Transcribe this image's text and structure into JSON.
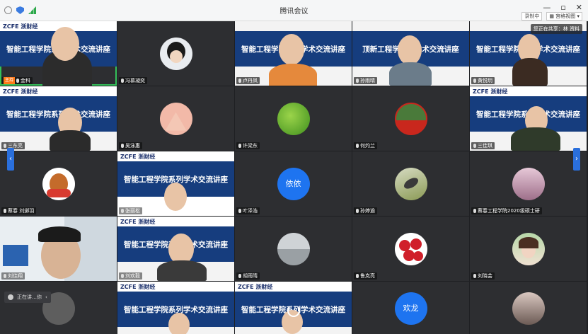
{
  "window": {
    "title": "腾讯会议"
  },
  "titlebar": {
    "minimize": "—",
    "restore": "▫",
    "close": "✕"
  },
  "toolbar": {
    "rec_badge": "录制中",
    "layout_label": "宫格视图"
  },
  "net_status": "您正在共享：林 资料",
  "slide": {
    "logo": "ZCFE 浙财经",
    "banner": "智能工程学院系列学术交流讲座",
    "banner_alt": "智能工程学院系列学术交流讲座",
    "banner_warp": "顶新工程学院精学术交流讲座"
  },
  "participants": [
    {
      "name": "金科",
      "host": "主持"
    },
    {
      "name": "冯慕凝奕"
    },
    {
      "name": "卢丹凤"
    },
    {
      "name": "孙雨晴"
    },
    {
      "name": "黄悦玥"
    },
    {
      "name": "三东亮"
    },
    {
      "name": "吴泳惠"
    },
    {
      "name": "许梁东"
    },
    {
      "name": "何灼兰"
    },
    {
      "name": "三佳琪"
    },
    {
      "name": "蔡春 刘邺羽"
    },
    {
      "name": "张丽松"
    },
    {
      "name": "叶泽浩"
    },
    {
      "name": "孙婷逾"
    },
    {
      "name": "蔡春工程学院2020级硕士研"
    },
    {
      "name": "刘佳翔"
    },
    {
      "name": "刘欢毅"
    },
    {
      "name": "胡雨晴"
    },
    {
      "name": "鲁岚亮"
    },
    {
      "name": "刘晓芸"
    }
  ],
  "avatars": {
    "text1": "依依",
    "text2": "欢龙"
  },
  "float_bar": {
    "label": "正在讲…你"
  },
  "colors": {
    "accent": "#34c15a",
    "banner": "#163d7e",
    "avatar_blue": "#1e74f0",
    "host_tag": "#ff7a1a"
  }
}
